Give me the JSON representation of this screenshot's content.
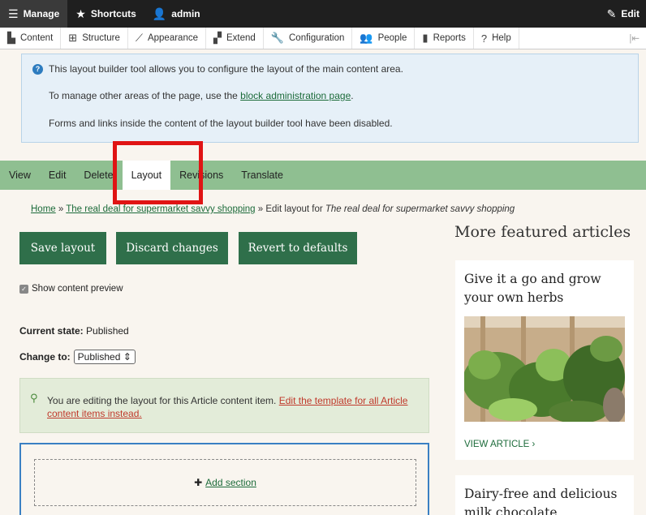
{
  "toolbar": {
    "manage": "Manage",
    "shortcuts": "Shortcuts",
    "user": "admin",
    "edit": "Edit",
    "tray": [
      {
        "label": "Content",
        "icon": "page-icon"
      },
      {
        "label": "Structure",
        "icon": "structure-icon"
      },
      {
        "label": "Appearance",
        "icon": "brush-icon"
      },
      {
        "label": "Extend",
        "icon": "puzzle-icon"
      },
      {
        "label": "Configuration",
        "icon": "wrench-icon"
      },
      {
        "label": "People",
        "icon": "people-icon"
      },
      {
        "label": "Reports",
        "icon": "bar-chart-icon"
      },
      {
        "label": "Help",
        "icon": "help-icon"
      }
    ]
  },
  "message": {
    "line1": "This layout builder tool allows you to configure the layout of the main content area.",
    "line2_pre": "To manage other areas of the page, use the ",
    "line2_link": "block administration page",
    "line2_post": ".",
    "line3": "Forms and links inside the content of the layout builder tool have been disabled."
  },
  "tabs": [
    "View",
    "Edit",
    "Delete",
    "Layout",
    "Revisions",
    "Translate"
  ],
  "active_tab": "Layout",
  "breadcrumb": {
    "home": "Home",
    "sep": " » ",
    "article": "The real deal for supermarket savvy shopping",
    "edit_prefix": " » Edit layout for ",
    "edit_title": "The real deal for supermarket savvy shopping"
  },
  "buttons": {
    "save": "Save layout",
    "discard": "Discard changes",
    "revert": "Revert to defaults"
  },
  "preview_label": "Show content preview",
  "state": {
    "current_label": "Current state:",
    "current_value": " Published",
    "change_label": "Change to:",
    "change_value": "Published"
  },
  "edit_note": {
    "text": "You are editing the layout for this Article content item. ",
    "link": "Edit the template for all Article content items instead."
  },
  "add_section": "Add section",
  "sidebar": {
    "title": "More featured articles",
    "card1_title": "Give it a go and grow your own herbs",
    "card1_link": "VIEW ARTICLE",
    "card2_title": "Dairy-free and delicious milk chocolate"
  },
  "colors": {
    "tabs_bg": "#8fbf91",
    "button_bg": "#2f6f4a",
    "highlight": "#e01414"
  }
}
